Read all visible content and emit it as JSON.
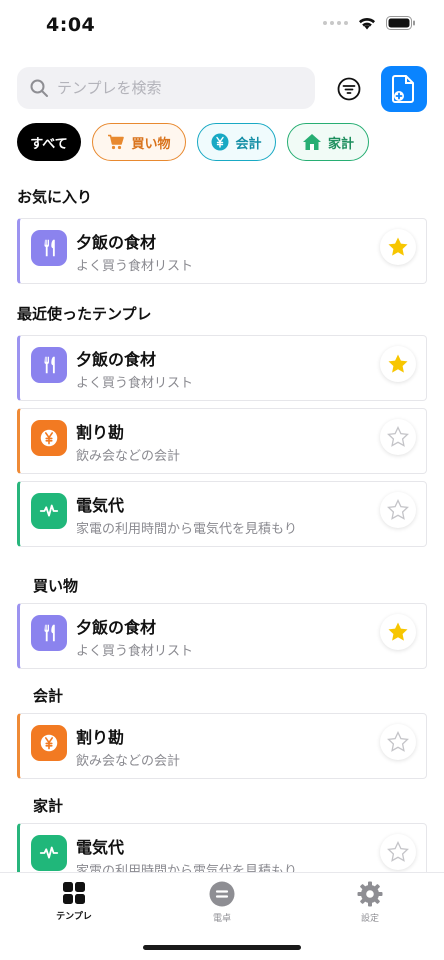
{
  "status": {
    "time": "4:04"
  },
  "search": {
    "placeholder": "テンプレを検索"
  },
  "chips": [
    {
      "label": "すべて"
    },
    {
      "label": "買い物"
    },
    {
      "label": "会計"
    },
    {
      "label": "家計"
    }
  ],
  "sections": {
    "favorites": "お気に入り",
    "recent": "最近使ったテンプレ",
    "shopping": "買い物",
    "accounting": "会計",
    "household": "家計"
  },
  "templates": {
    "dinner": {
      "title": "夕飯の食材",
      "subtitle": "よく買う食材リスト"
    },
    "split": {
      "title": "割り勘",
      "subtitle": "飲み会などの会計"
    },
    "electric": {
      "title": "電気代",
      "subtitle": "家電の利用時間から電気代を見積もり"
    }
  },
  "tabs": [
    {
      "label": "テンプレ"
    },
    {
      "label": "電卓"
    },
    {
      "label": "設定"
    }
  ],
  "colors": {
    "accent": "#0a84ff",
    "star_active": "#f7c600",
    "shopping": "#e8892f",
    "accounting": "#19a9c4",
    "household": "#27ae73",
    "dinner_icon": "#8b83ee"
  },
  "icons": {
    "search": "search-icon",
    "filter": "filter-icon",
    "new_template": "new-document-icon",
    "cart": "cart-icon",
    "yen": "yen-icon",
    "house": "house-icon",
    "fork_knife": "fork-knife-icon",
    "pulse": "pulse-icon",
    "star": "star-icon",
    "grid": "grid-icon",
    "calculator": "calculator-icon",
    "gear": "gear-icon"
  }
}
